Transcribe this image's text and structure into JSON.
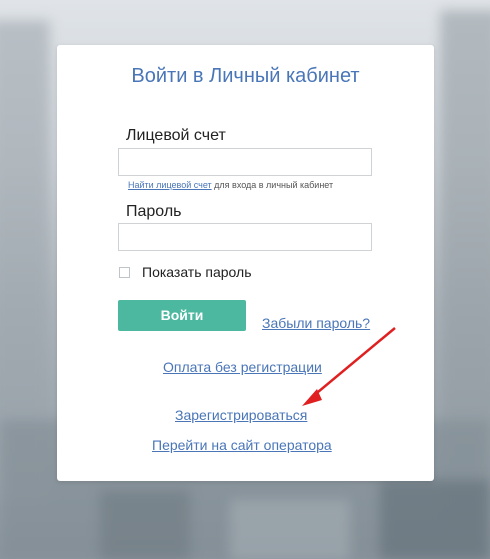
{
  "login": {
    "title": "Войти в Личный кабинет",
    "account_label": "Лицевой счет",
    "account_value": "",
    "hint_link": "Найти лицевой счет",
    "hint_text": " для входа в личный кабинет",
    "password_label": "Пароль",
    "password_value": "",
    "show_password_label": "Показать пароль",
    "submit_label": "Войти",
    "forgot_link": "Забыли пароль?",
    "pay_link": "Оплата без регистрации",
    "register_link": "Зарегистрироваться",
    "operator_link": "Перейти на сайт оператора"
  },
  "colors": {
    "accent": "#4a76b8",
    "button": "#4db8a0",
    "arrow": "#e02020"
  }
}
